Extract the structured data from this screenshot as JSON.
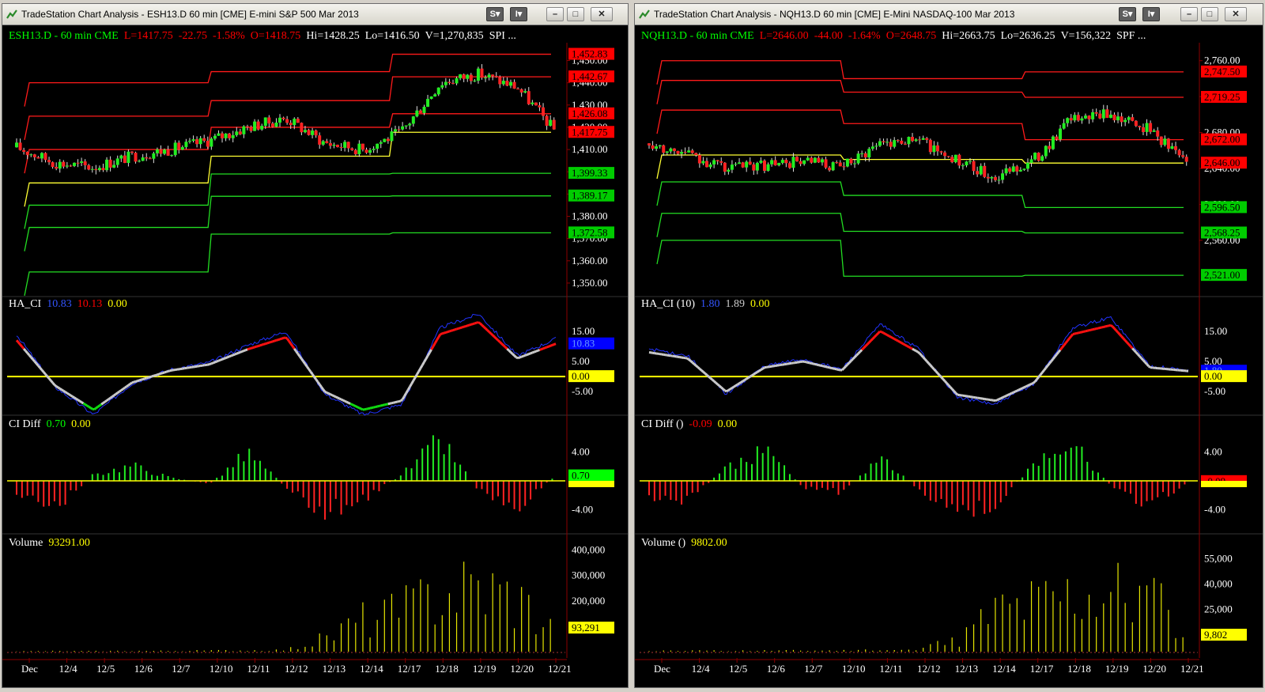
{
  "windows": [
    {
      "title": "TradeStation Chart Analysis - ESH13.D 60 min [CME] E-mini S&P 500 Mar 2013",
      "buttons": {
        "s": "S",
        "i": "I"
      },
      "header": {
        "symbol": "ESH13.D - 60 min  CME",
        "last": "L=1417.75",
        "change": "-22.75",
        "pct": "-1.58%",
        "open": "O=1418.75",
        "hi": "Hi=1428.25",
        "lo": "Lo=1416.50",
        "vol": "V=1,270,835",
        "extra": "SPI ..."
      },
      "ind1": {
        "name": "HA_CI",
        "v1": "10.83",
        "v2": "10.13",
        "v3": "0.00"
      },
      "ind2": {
        "name": "CI Diff",
        "v1": "0.70",
        "v2": "0.00"
      },
      "ind3": {
        "name": "Volume",
        "v1": "93291.00"
      },
      "price_ticks": [
        "1,450.00",
        "1,440.00",
        "1,430.00",
        "1,420.00",
        "1,410.00",
        "1,400.00",
        "1,390.00",
        "1,380.00",
        "1,370.00",
        "1,360.00",
        "1,350.00"
      ],
      "price_tags": [
        {
          "text": "1,452.83",
          "color": "#ff0000"
        },
        {
          "text": "1,442.67",
          "color": "#ff0000"
        },
        {
          "text": "1,426.08",
          "color": "#ff0000"
        },
        {
          "text": "1,417.75",
          "color": "#ff0000"
        },
        {
          "text": "1,399.33",
          "color": "#00cc00"
        },
        {
          "text": "1,389.17",
          "color": "#00cc00"
        },
        {
          "text": "1,372.58",
          "color": "#00cc00"
        }
      ],
      "osc_ticks": [
        "15.00",
        "5.00",
        "0.00",
        "-5.00"
      ],
      "osc_tags": [
        {
          "text": "10.83",
          "color": "#0000ff"
        },
        {
          "text": "0.00",
          "color": "#ffff00"
        }
      ],
      "diff_ticks": [
        "4.00",
        "0.00",
        "-4.00"
      ],
      "diff_tag": {
        "text": "0.70",
        "color": "#00ff00"
      },
      "vol_ticks": [
        "400,000",
        "300,000",
        "200,000",
        "100,000"
      ],
      "vol_tag": {
        "text": "93,291",
        "color": "#ffff00"
      },
      "dates": [
        "Dec",
        "12/4",
        "12/5",
        "12/6",
        "12/7",
        "12/10",
        "12/11",
        "12/12",
        "12/13",
        "12/14",
        "12/17",
        "12/18",
        "12/19",
        "12/20",
        "12/21"
      ]
    },
    {
      "title": "TradeStation Chart Analysis - NQH13.D 60 min [CME] E-Mini NASDAQ-100 Mar 2013",
      "buttons": {
        "s": "S",
        "i": "I"
      },
      "header": {
        "symbol": "NQH13.D - 60 min  CME",
        "last": "L=2646.00",
        "change": "-44.00",
        "pct": "-1.64%",
        "open": "O=2648.75",
        "hi": "Hi=2663.75",
        "lo": "Lo=2636.25",
        "vol": "V=156,322",
        "extra": "SPF ..."
      },
      "ind1": {
        "name": "HA_CI (10)",
        "v1": "1.80",
        "v2": "1.89",
        "v3": "0.00"
      },
      "ind2": {
        "name": "CI Diff ()",
        "v1": "-0.09",
        "v2": "0.00"
      },
      "ind3": {
        "name": "Volume ()",
        "v1": "9802.00"
      },
      "price_ticks": [
        "2,760.00",
        "2,720.00",
        "2,680.00",
        "2,640.00",
        "2,600.00",
        "2,560.00"
      ],
      "price_tags": [
        {
          "text": "2,747.50",
          "color": "#ff0000"
        },
        {
          "text": "2,719.25",
          "color": "#ff0000"
        },
        {
          "text": "2,672.00",
          "color": "#ff0000"
        },
        {
          "text": "2,646.00",
          "color": "#ff0000"
        },
        {
          "text": "2,596.50",
          "color": "#00cc00"
        },
        {
          "text": "2,568.25",
          "color": "#00cc00"
        },
        {
          "text": "2,521.00",
          "color": "#00cc00"
        }
      ],
      "osc_ticks": [
        "15.00",
        "5.00",
        "-5.00"
      ],
      "osc_tags": [
        {
          "text": "1.80",
          "color": "#0000ff"
        },
        {
          "text": "0.00",
          "color": "#ffff00"
        }
      ],
      "diff_ticks": [
        "4.00",
        "-4.00"
      ],
      "diff_tag": {
        "text": "-0.09",
        "color": "#ff0000"
      },
      "vol_ticks": [
        "55,000",
        "40,000",
        "25,000"
      ],
      "vol_tag": {
        "text": "9,802",
        "color": "#ffff00"
      },
      "dates": [
        "Dec",
        "12/4",
        "12/5",
        "12/6",
        "12/7",
        "12/10",
        "12/11",
        "12/12",
        "12/13",
        "12/14",
        "12/17",
        "12/18",
        "12/19",
        "12/20",
        "12/21"
      ]
    }
  ],
  "chart_data": [
    {
      "type": "candlestick",
      "title": "ESH13.D - 60 min CME",
      "x": [
        "Dec",
        "12/4",
        "12/5",
        "12/6",
        "12/7",
        "12/10",
        "12/11",
        "12/12",
        "12/13",
        "12/14",
        "12/17",
        "12/18",
        "12/19",
        "12/20",
        "12/21"
      ],
      "close": [
        1411,
        1404,
        1402,
        1407,
        1410,
        1414,
        1420,
        1424,
        1413,
        1410,
        1418,
        1440,
        1444,
        1438,
        1418
      ],
      "ylim": [
        1345,
        1458
      ],
      "pivot_levels": {
        "r3": [
          1440,
          1445,
          1452.83
        ],
        "r2": [
          1425,
          1432,
          1442.67
        ],
        "r1": [
          1410,
          1420,
          1426.08
        ],
        "pp": [
          1395,
          1407,
          1417.75
        ],
        "s1": [
          1385,
          1399,
          1399.33
        ],
        "s2": [
          1375,
          1389,
          1389.17
        ],
        "s3": [
          1355,
          1372,
          1372.58
        ]
      },
      "ha_ci": [
        12,
        -3,
        -11,
        -2,
        2,
        4,
        9,
        13,
        -5,
        -11,
        -8,
        14,
        18,
        6,
        10.83
      ],
      "ci_diff": [
        -2.5,
        -4.5,
        1,
        2.5,
        0.5,
        -0.5,
        4.5,
        -1,
        -5,
        -3,
        1,
        6.5,
        -1.5,
        -4,
        0.7
      ],
      "volume": [
        2000,
        3000,
        2500,
        4000,
        3500,
        5000,
        6000,
        8000,
        60000,
        150000,
        180000,
        280000,
        300000,
        250000,
        93291
      ]
    },
    {
      "type": "candlestick",
      "title": "NQH13.D - 60 min CME",
      "x": [
        "Dec",
        "12/4",
        "12/5",
        "12/6",
        "12/7",
        "12/10",
        "12/11",
        "12/12",
        "12/13",
        "12/14",
        "12/17",
        "12/18",
        "12/19",
        "12/20",
        "12/21"
      ],
      "close": [
        2668,
        2656,
        2640,
        2644,
        2648,
        2640,
        2670,
        2672,
        2648,
        2630,
        2650,
        2696,
        2700,
        2684,
        2646
      ],
      "ylim": [
        2500,
        2780
      ],
      "pivot_levels": {
        "r3": [
          2760,
          2740,
          2747.5
        ],
        "r2": [
          2738,
          2725,
          2719.25
        ],
        "r1": [
          2705,
          2690,
          2672.0
        ],
        "pp": [
          2655,
          2650,
          2646.0
        ],
        "s1": [
          2625,
          2610,
          2596.5
        ],
        "s2": [
          2590,
          2570,
          2568.25
        ],
        "s3": [
          2560,
          2520,
          2521.0
        ]
      },
      "ha_ci": [
        8,
        6,
        -5,
        3,
        5,
        2,
        15,
        8,
        -6,
        -8,
        -2,
        14,
        17,
        3,
        1.8
      ],
      "ci_diff": [
        -3,
        -3,
        2,
        5,
        -1,
        -2,
        4,
        -1.5,
        -5,
        -4,
        3,
        6,
        -1,
        -4,
        -0.09
      ],
      "volume": [
        500,
        600,
        700,
        800,
        800,
        900,
        1000,
        1200,
        8000,
        30000,
        35000,
        42000,
        45000,
        38000,
        9802
      ]
    }
  ]
}
